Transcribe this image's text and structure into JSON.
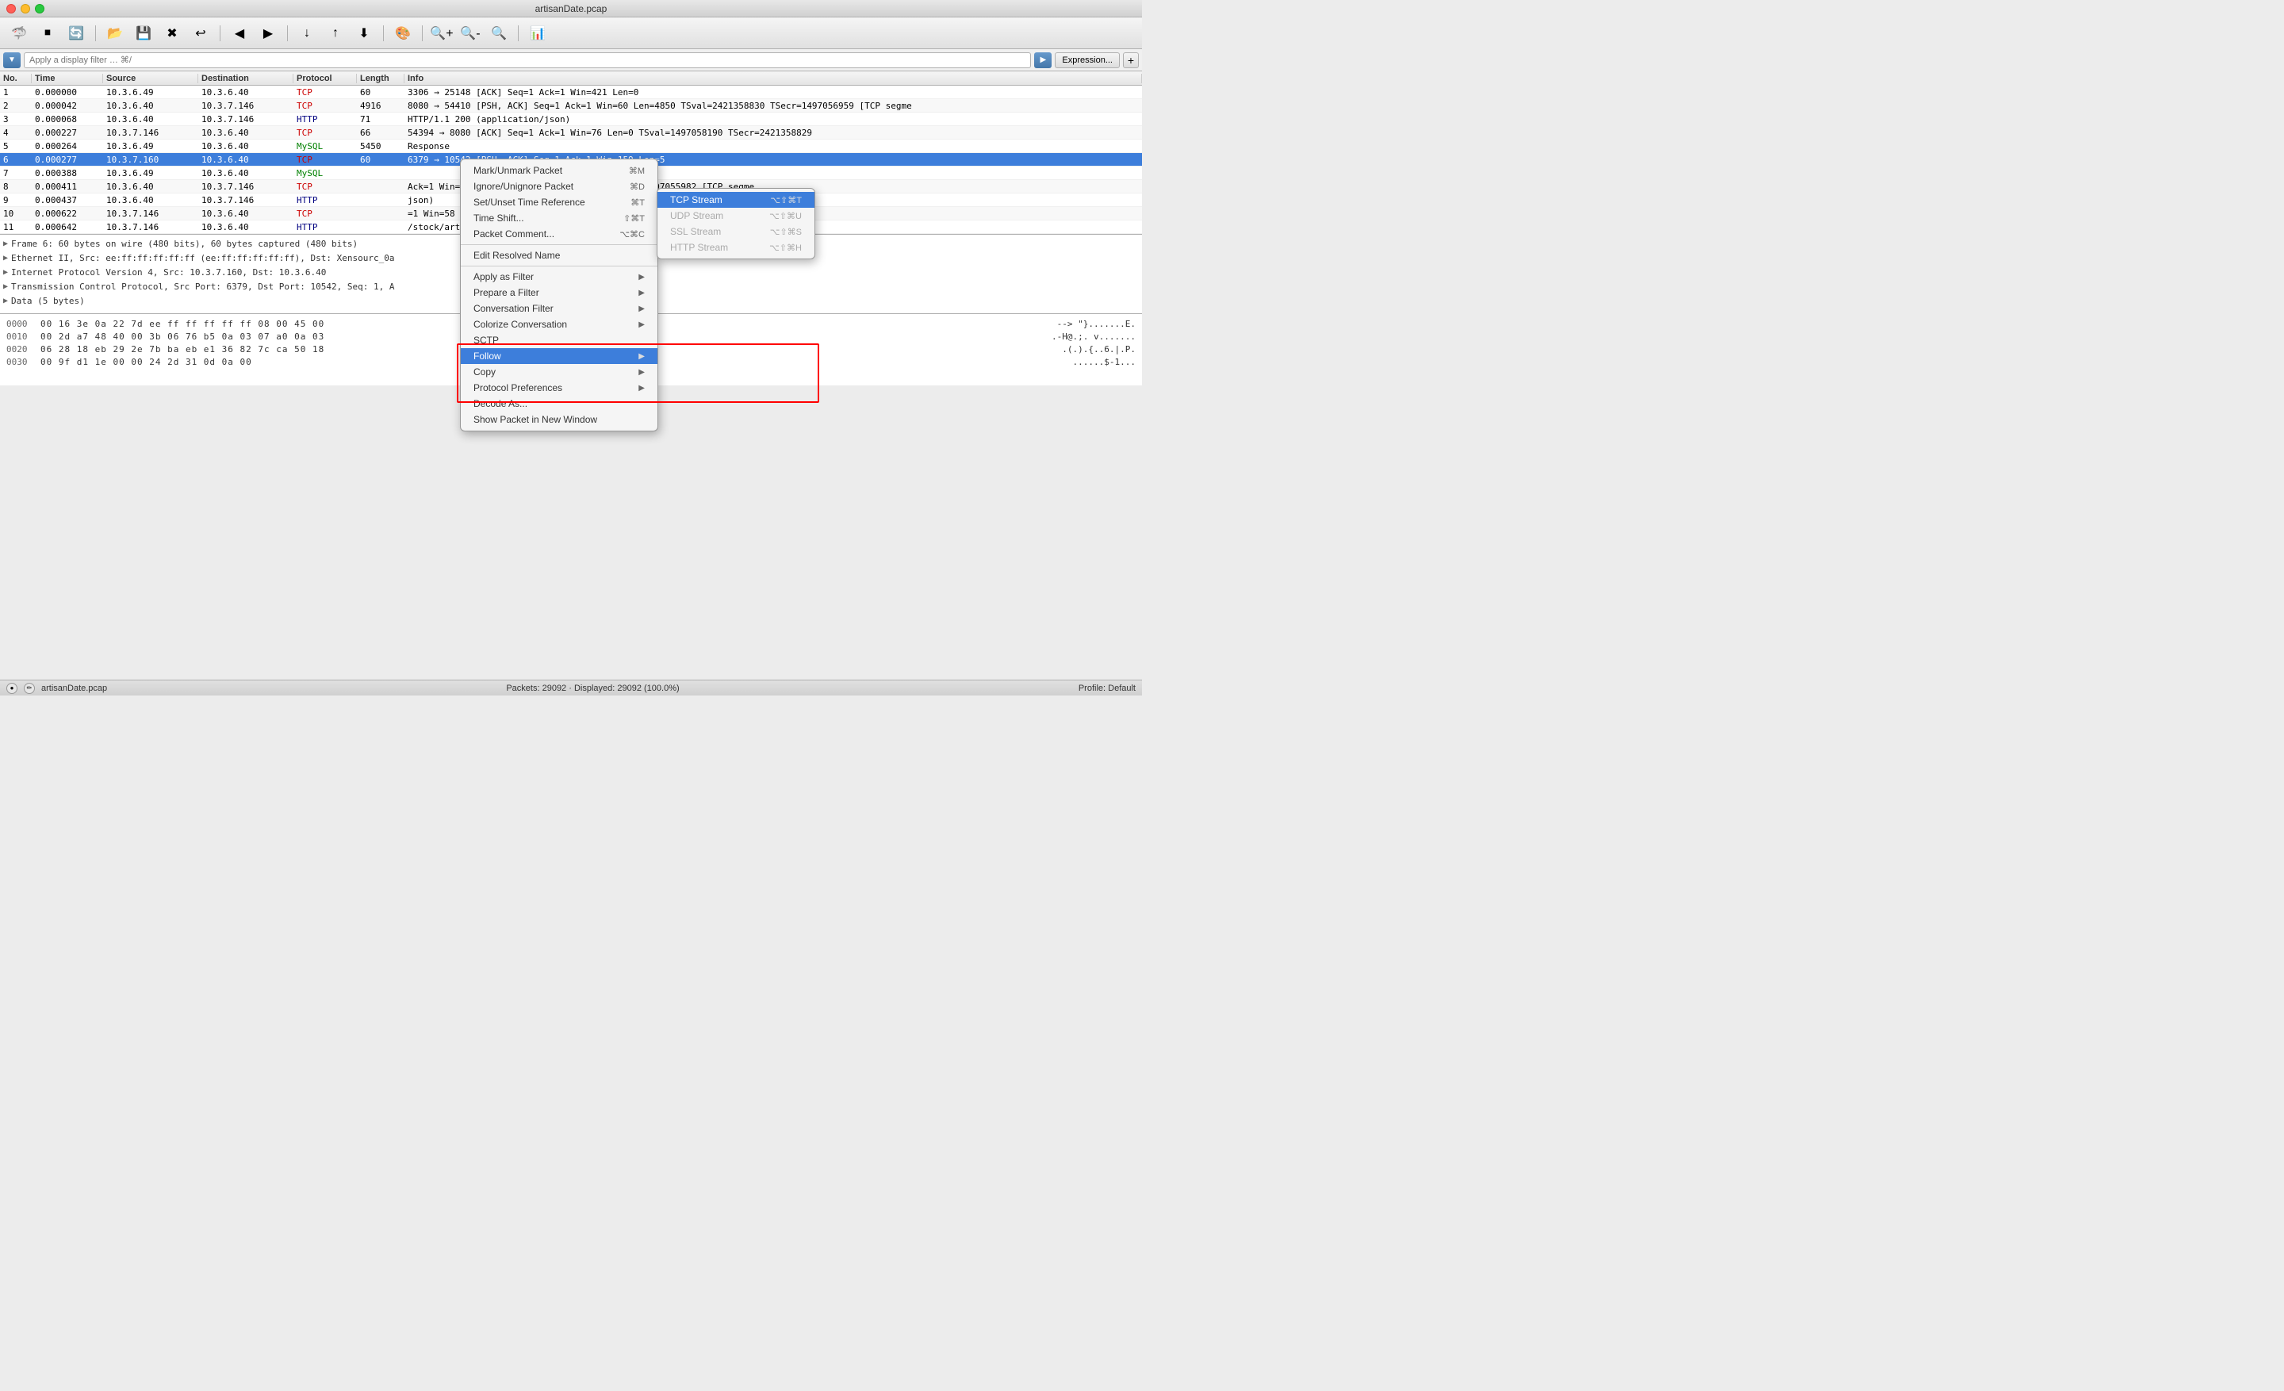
{
  "titlebar": {
    "title": "artisanDate.pcap"
  },
  "toolbar": {
    "buttons": [
      "🔥",
      "⏹",
      "🔄",
      "✂️",
      "📋",
      "✖",
      "🔃",
      "⬅",
      "➡",
      "↓",
      "↑",
      "⬇",
      "📋",
      "🔍",
      "🔍-",
      "🔍+",
      "📊"
    ]
  },
  "filterbar": {
    "placeholder": "Apply a display filter … ⌘/",
    "expression_label": "Expression...",
    "plus_label": "+"
  },
  "packet_list": {
    "columns": [
      "No.",
      "Time",
      "Source",
      "Destination",
      "Protocol",
      "Length",
      "Info"
    ],
    "rows": [
      {
        "no": "1",
        "time": "0.000000",
        "src": "10.3.6.49",
        "dst": "10.3.6.40",
        "proto": "TCP",
        "len": "60",
        "info": "3306 → 25148 [ACK] Seq=1 Ack=1 Win=421 Len=0",
        "selected": false,
        "color": "white"
      },
      {
        "no": "2",
        "time": "0.000042",
        "src": "10.3.6.40",
        "dst": "10.3.7.146",
        "proto": "TCP",
        "len": "4916",
        "info": "8080 → 54410 [PSH, ACK] Seq=1 Ack=1 Win=60 Len=4850 TSval=2421358830 TSecr=1497056959 [TCP segme",
        "selected": false,
        "color": "white"
      },
      {
        "no": "3",
        "time": "0.000068",
        "src": "10.3.6.40",
        "dst": "10.3.7.146",
        "proto": "HTTP",
        "len": "71",
        "info": "HTTP/1.1 200   (application/json)",
        "selected": false,
        "color": "white"
      },
      {
        "no": "4",
        "time": "0.000227",
        "src": "10.3.7.146",
        "dst": "10.3.6.40",
        "proto": "TCP",
        "len": "66",
        "info": "54394 → 8080 [ACK] Seq=1 Ack=1 Win=76 Len=0 TSval=1497058190 TSecr=2421358829",
        "selected": false,
        "color": "white"
      },
      {
        "no": "5",
        "time": "0.000264",
        "src": "10.3.6.49",
        "dst": "10.3.6.40",
        "proto": "MySQL",
        "len": "5450",
        "info": "Response",
        "selected": false,
        "color": "white"
      },
      {
        "no": "6",
        "time": "0.000277",
        "src": "10.3.7.160",
        "dst": "10.3.6.40",
        "proto": "TCP",
        "len": "60",
        "info": "6379 → 10542 [PSH, ACK] Seq=1 Ack=1 Win=159 Len=5",
        "selected": true,
        "color": "blue"
      },
      {
        "no": "7",
        "time": "0.000388",
        "src": "10.3.6.49",
        "dst": "10.3.6.40",
        "proto": "MySQL",
        "len": "",
        "info": "",
        "selected": false,
        "color": "white"
      },
      {
        "no": "8",
        "time": "0.000411",
        "src": "10.3.6.40",
        "dst": "10.3.7.146",
        "proto": "TCP",
        "len": "",
        "info": "Ack=1 Win=60 Len=4849 TSval=2421358831 TSecr=1497055982 [TCP segme",
        "selected": false,
        "color": "white"
      },
      {
        "no": "9",
        "time": "0.000437",
        "src": "10.3.6.40",
        "dst": "10.3.7.146",
        "proto": "HTTP",
        "len": "",
        "info": "json)",
        "selected": false,
        "color": "white"
      },
      {
        "no": "10",
        "time": "0.000622",
        "src": "10.3.7.146",
        "dst": "10.3.6.40",
        "proto": "TCP",
        "len": "",
        "info": "=1 Win=58 Len=0 TSval=1497058190 TSecr=2421358830",
        "selected": false,
        "color": "white"
      },
      {
        "no": "11",
        "time": "0.000642",
        "src": "10.3.7.146",
        "dst": "10.3.6.40",
        "proto": "HTTP",
        "len": "",
        "info": "/stock/artisanDate HTTP/1.1  (application/x-www-form-urlencoded)",
        "selected": false,
        "color": "white"
      }
    ]
  },
  "packet_detail": {
    "rows": [
      {
        "indent": 0,
        "arrow": "▶",
        "text": "Frame 6: 60 bytes on wire (480 bits), 60 bytes captured (480 bits)"
      },
      {
        "indent": 0,
        "arrow": "▶",
        "text": "Ethernet II, Src: ee:ff:ff:ff:ff:ff (ee:ff:ff:ff:ff:ff), Dst: Xensourc_0a"
      },
      {
        "indent": 0,
        "arrow": "▶",
        "text": "Internet Protocol Version 4, Src: 10.3.7.160, Dst: 10.3.6.40"
      },
      {
        "indent": 0,
        "arrow": "▶",
        "text": "Transmission Control Protocol, Src Port: 6379, Dst Port: 10542, Seq: 1, A"
      },
      {
        "indent": 0,
        "arrow": "▶",
        "text": "Data (5 bytes)"
      }
    ]
  },
  "hex_dump": {
    "rows": [
      {
        "offset": "0000",
        "bytes": "00 16 3e 0a 22 7d ee ff  ff ff ff ff 08 00 45 00",
        "ascii": "--> \"}.......E."
      },
      {
        "offset": "0010",
        "bytes": "00 2d a7 48 40 00 3b 06  76 b5 0a 03 07 a0 0a 03",
        "ascii": ".-H@.;. v......."
      },
      {
        "offset": "0020",
        "bytes": "06 28 18 eb 29 2e 7b ba  eb e1 36 82 7c ca 50 18",
        "ascii": ".(.).{..6.|.P."
      },
      {
        "offset": "0030",
        "bytes": "00 9f d1 1e 00 00 24 2d  31 0d 0a 00",
        "ascii": "......$-1..."
      }
    ]
  },
  "context_menu": {
    "items": [
      {
        "label": "Mark/Unmark Packet",
        "shortcut": "⌘M",
        "has_submenu": false,
        "disabled": false,
        "separator_after": false
      },
      {
        "label": "Ignore/Unignore Packet",
        "shortcut": "⌘D",
        "has_submenu": false,
        "disabled": false,
        "separator_after": false
      },
      {
        "label": "Set/Unset Time Reference",
        "shortcut": "⌘T",
        "has_submenu": false,
        "disabled": false,
        "separator_after": false
      },
      {
        "label": "Time Shift...",
        "shortcut": "⇧⌘T",
        "has_submenu": false,
        "disabled": false,
        "separator_after": false
      },
      {
        "label": "Packet Comment...",
        "shortcut": "⌥⌘C",
        "has_submenu": false,
        "disabled": false,
        "separator_after": true
      },
      {
        "label": "Edit Resolved Name",
        "shortcut": "",
        "has_submenu": false,
        "disabled": false,
        "separator_after": true
      },
      {
        "label": "Apply as Filter",
        "shortcut": "",
        "has_submenu": true,
        "disabled": false,
        "separator_after": false
      },
      {
        "label": "Prepare a Filter",
        "shortcut": "",
        "has_submenu": true,
        "disabled": false,
        "separator_after": false
      },
      {
        "label": "Conversation Filter",
        "shortcut": "",
        "has_submenu": true,
        "disabled": false,
        "separator_after": false
      },
      {
        "label": "Colorize Conversation",
        "shortcut": "",
        "has_submenu": true,
        "disabled": false,
        "separator_after": false
      },
      {
        "label": "SCTP",
        "shortcut": "",
        "has_submenu": false,
        "disabled": false,
        "separator_after": false
      },
      {
        "label": "Follow",
        "shortcut": "",
        "has_submenu": true,
        "disabled": false,
        "highlighted": true,
        "separator_after": false
      },
      {
        "label": "Copy",
        "shortcut": "",
        "has_submenu": true,
        "disabled": false,
        "separator_after": false
      },
      {
        "label": "Protocol Preferences",
        "shortcut": "",
        "has_submenu": true,
        "disabled": false,
        "separator_after": false
      },
      {
        "label": "Decode As...",
        "shortcut": "",
        "has_submenu": false,
        "disabled": false,
        "separator_after": false
      },
      {
        "label": "Show Packet in New Window",
        "shortcut": "",
        "has_submenu": false,
        "disabled": false,
        "separator_after": false
      }
    ]
  },
  "submenu": {
    "items": [
      {
        "label": "TCP Stream",
        "shortcut": "⌥⇧⌘T",
        "highlighted": true,
        "disabled": false
      },
      {
        "label": "UDP Stream",
        "shortcut": "⌥⇧⌘U",
        "highlighted": false,
        "disabled": true
      },
      {
        "label": "SSL Stream",
        "shortcut": "⌥⇧⌘S",
        "highlighted": false,
        "disabled": true
      },
      {
        "label": "HTTP Stream",
        "shortcut": "⌥⇧⌘H",
        "highlighted": false,
        "disabled": true
      }
    ]
  },
  "statusbar": {
    "packets_info": "Packets: 29092 · Displayed: 29092 (100.0%)",
    "profile": "Profile: Default"
  }
}
